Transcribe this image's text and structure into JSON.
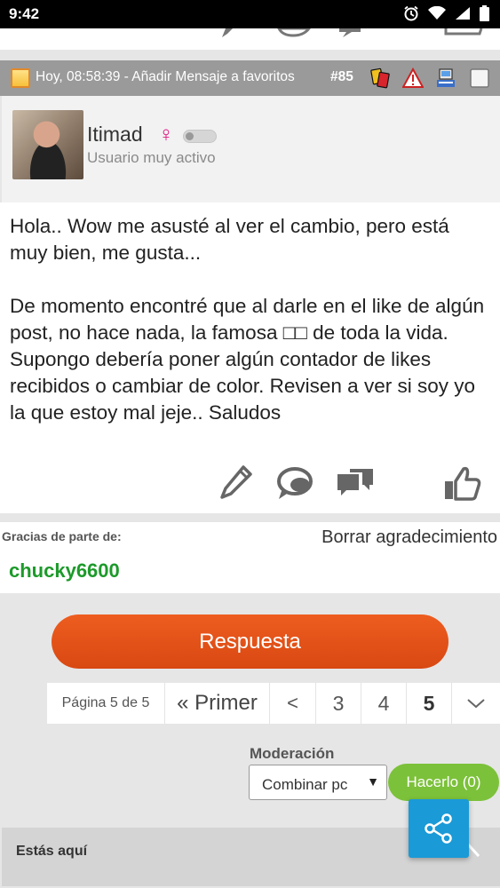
{
  "status_bar": {
    "time": "9:42"
  },
  "post": {
    "date_text": "Hoy, 08:58:39",
    "separator": " - ",
    "favorite_link": "Añadir Mensaje a favoritos",
    "number": "#85",
    "user": {
      "name": "Itimad",
      "gender_symbol": "♀",
      "title": "Usuario muy activo"
    },
    "message": "Hola.. Wow me asusté al ver el cambio, pero está muy bien, me gusta...\n\nDe momento encontré que al darle en el like de algún post, no hace nada, la famosa □□ de toda la vida. Supongo debería poner algún contador de likes recibidos o cambiar de color. Revisen a ver si soy yo la que estoy mal jeje.. Saludos"
  },
  "thanks": {
    "label": "Gracias de parte de:",
    "remove_label": "Borrar agradecimiento",
    "users": [
      "chucky6600"
    ]
  },
  "reply_button": "Respuesta",
  "pagination": {
    "info": "Página 5 de 5",
    "first_label": "« Primer",
    "prev_label": "<",
    "pages": [
      "3",
      "4",
      "5"
    ],
    "current": "5"
  },
  "moderation": {
    "label": "Moderación",
    "selected": "Combinar pc",
    "submit_label": "Hacerlo (0)"
  },
  "breadcrumb": {
    "label": "Estás aquí"
  },
  "colors": {
    "reply": "#e2521a",
    "thanks_user": "#1d9a2a",
    "moderation_button": "#7cc13a",
    "share": "#1a9ad6",
    "header_bar": "#9a9a9a"
  },
  "icons": {
    "status": [
      "alarm-icon",
      "wifi-icon",
      "signal-icon",
      "battery-icon"
    ],
    "header": [
      "yellow-card-icon",
      "warning-icon",
      "computer-icon",
      "checkbox-icon"
    ],
    "actions": [
      "edit-pencil-icon",
      "comment-bubble-icon",
      "quote-bubbles-icon",
      "thumbs-up-icon"
    ]
  }
}
